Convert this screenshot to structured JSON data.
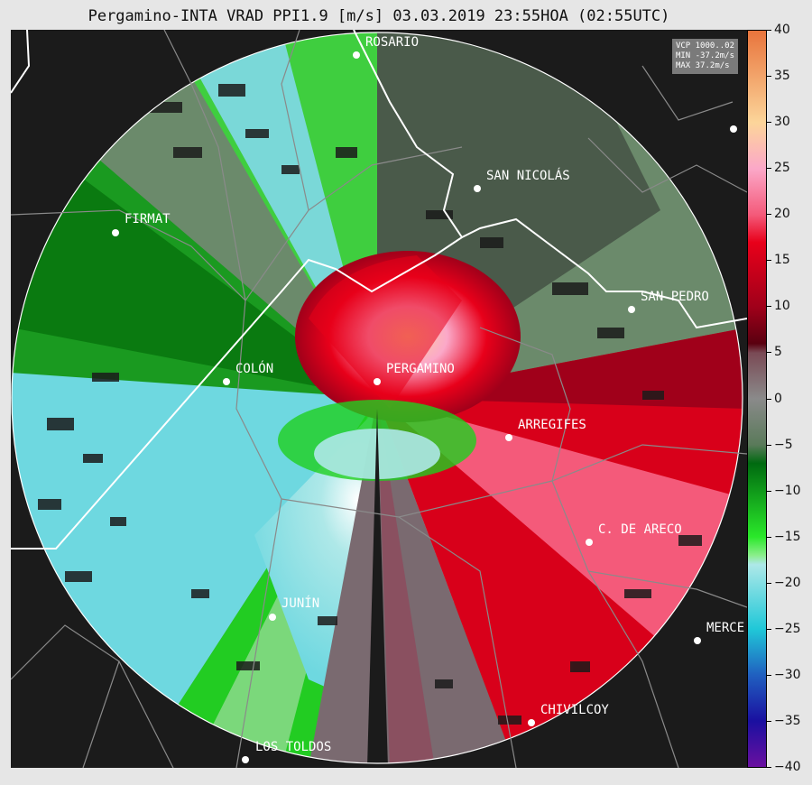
{
  "title": "Pergamino-INTA VRAD PPI1.9 [m/s] 03.03.2019 23:55HOA (02:55UTC)",
  "info": {
    "vcp": "VCP 1000..02",
    "min": "MIN -37.2m/s",
    "max": "MAX 37.2m/s"
  },
  "cities": [
    {
      "name": "ROSARIO"
    },
    {
      "name": "SAN NICOLÁS"
    },
    {
      "name": "FIRMAT"
    },
    {
      "name": "SAN PEDRO"
    },
    {
      "name": "COLÓN"
    },
    {
      "name": "PERGAMINO"
    },
    {
      "name": "ARREGIFES"
    },
    {
      "name": "C. DE ARECO"
    },
    {
      "name": "JUNÍN"
    },
    {
      "name": "MERCE"
    },
    {
      "name": "CHIVILCOY"
    },
    {
      "name": "LOS TOLDOS"
    }
  ],
  "colorbar": {
    "min": -40,
    "max": 40,
    "ticks": [
      "40",
      "35",
      "30",
      "25",
      "20",
      "15",
      "10",
      "5",
      "0",
      "−5",
      "−10",
      "−15",
      "−20",
      "−25",
      "−30",
      "−35",
      "−40"
    ],
    "stops": [
      {
        "value": 40,
        "color": "#e8743c"
      },
      {
        "value": 30,
        "color": "#fcd59a"
      },
      {
        "value": 25,
        "color": "#fba8c8"
      },
      {
        "value": 20,
        "color": "#f45a7a"
      },
      {
        "value": 17,
        "color": "#e8001a"
      },
      {
        "value": 10,
        "color": "#a0001a"
      },
      {
        "value": 6,
        "color": "#5a0010"
      },
      {
        "value": 5,
        "color": "#7a4a55"
      },
      {
        "value": 0,
        "color": "#8a8a8a"
      },
      {
        "value": -5,
        "color": "#5a7a5a"
      },
      {
        "value": -7,
        "color": "#006a10"
      },
      {
        "value": -15,
        "color": "#2ae82a"
      },
      {
        "value": -17,
        "color": "#8aee8a"
      },
      {
        "value": -18,
        "color": "#aee8e8"
      },
      {
        "value": -25,
        "color": "#20c8d8"
      },
      {
        "value": -30,
        "color": "#2060c0"
      },
      {
        "value": -35,
        "color": "#1a10a0"
      },
      {
        "value": -40,
        "color": "#6a10a0"
      }
    ]
  }
}
